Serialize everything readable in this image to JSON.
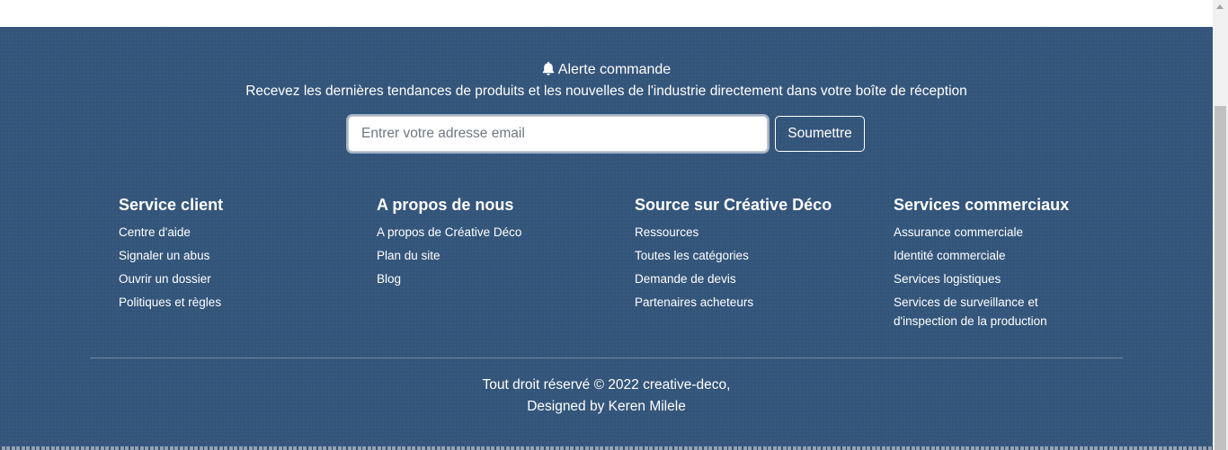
{
  "newsletter": {
    "icon": "bell-icon",
    "title": "Alerte commande",
    "subtitle": "Recevez les dernières tendances de produits et les nouvelles de l'industrie directement dans votre boîte de réception",
    "email_placeholder": "Entrer votre adresse email",
    "email_value": "",
    "submit_label": "Soumettre"
  },
  "columns": [
    {
      "title": "Service client",
      "links": [
        "Centre d'aide",
        "Signaler un abus",
        "Ouvrir un dossier",
        "Politiques et règles"
      ]
    },
    {
      "title": "A propos de nous",
      "links": [
        "A propos de Créative Déco",
        "Plan du site",
        "Blog"
      ]
    },
    {
      "title": "Source sur Créative Déco",
      "links": [
        "Ressources",
        "Toutes les catégories",
        "Demande de devis",
        "Partenaires acheteurs"
      ]
    },
    {
      "title": "Services commerciaux",
      "links": [
        "Assurance commerciale",
        "Identité commerciale",
        "Services logistiques",
        "Services de surveillance et d'inspection de la production"
      ]
    }
  ],
  "copyright": {
    "line1": "Tout droit réservé © 2022 creative-deco,",
    "line2": "Designed by Keren Milele"
  },
  "colors": {
    "footer_bg": "#33557a",
    "text": "#ffffff"
  }
}
